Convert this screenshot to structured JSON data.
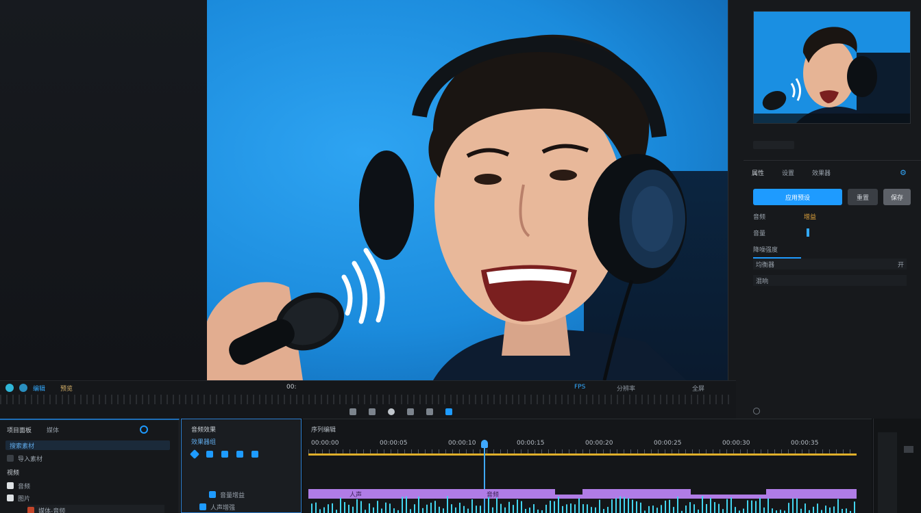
{
  "colors": {
    "accent": "#1e9bff",
    "timeline_clip": "#b07ce6",
    "playhead": "#3fa9ff",
    "work_area": "#e0b02a",
    "waveform": "#43d6f0"
  },
  "icons": [
    "wifi-waves-icon",
    "play-icon",
    "gear-icon",
    "add-icon",
    "search-icon",
    "folder-icon",
    "record-icon"
  ],
  "transport": {
    "left_label": "编辑",
    "left_small": "预览",
    "center_timecode": "00:",
    "right_labels": [
      "FPS",
      "分辨率",
      "全屏"
    ]
  },
  "right_panel": {
    "tabs": [
      "属性",
      "设置",
      "效果器"
    ],
    "primary_button": "应用预设",
    "secondary_buttons": [
      "重置",
      "保存"
    ],
    "properties": [
      {
        "label": "音频",
        "value": "增益"
      },
      {
        "label": "音量",
        "value": ""
      },
      {
        "label": "降噪强度",
        "value": ""
      },
      {
        "label": "均衡器",
        "value": "开"
      },
      {
        "label": "混响",
        "value": ""
      }
    ]
  },
  "project_panel": {
    "title": "项目面板",
    "tab2": "媒体",
    "search_placeholder": "搜索素材",
    "items": [
      "导入素材",
      "视频",
      "音频",
      "图片"
    ],
    "footer": "媒体-音频"
  },
  "effects_panel": {
    "title": "音频效果",
    "subtitle": "效果器组",
    "rows": [
      "音量增益",
      "人声增强"
    ]
  },
  "timeline": {
    "sequence_label": "序列编辑",
    "ruler": [
      "00:00:00",
      "00:00:05",
      "00:00:10",
      "00:00:15",
      "00:00:20",
      "00:00:25",
      "00:00:30",
      "00:00:35"
    ],
    "clip_labels": [
      "人声",
      "音频"
    ]
  },
  "playhead_fraction": 0.32
}
